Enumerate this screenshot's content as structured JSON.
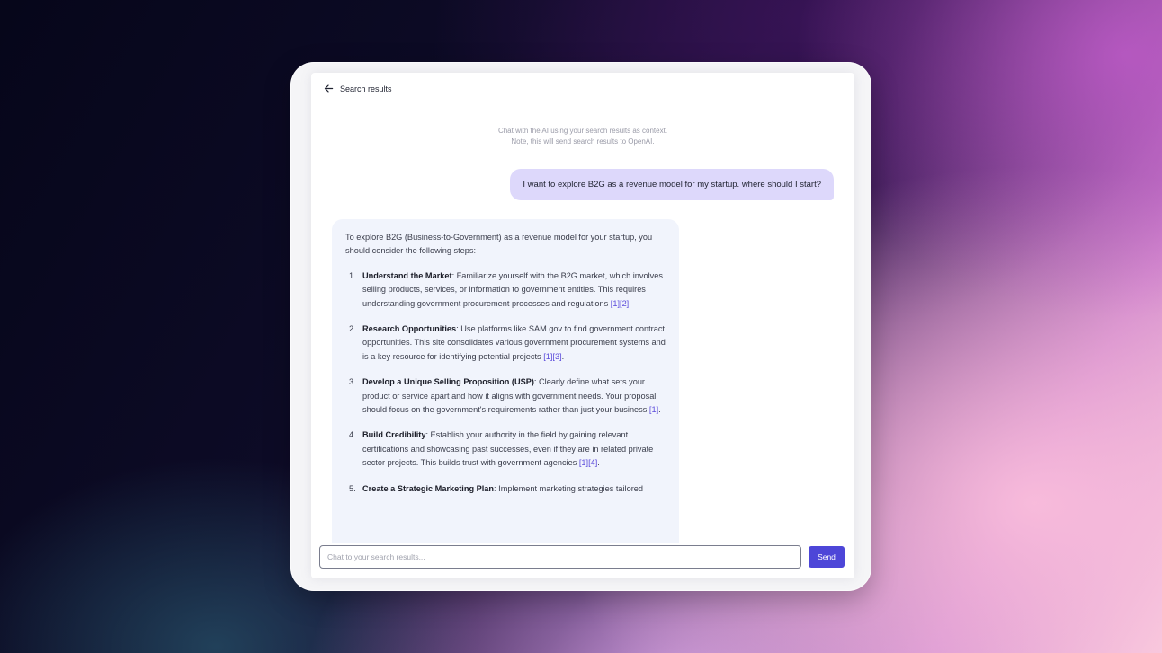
{
  "header": {
    "back_label": "Search results",
    "back_icon": "arrow-left-icon"
  },
  "hint": {
    "line1": "Chat with the AI using your search results as context.",
    "line2": "Note, this will send search results to OpenAI."
  },
  "messages": {
    "user": "I want to explore B2G as a revenue model for my startup. where should I start?",
    "ai": {
      "intro": "To explore B2G (Business-to-Government) as a revenue model for your startup, you should consider the following steps:",
      "steps": [
        {
          "num": "1.",
          "title": "Understand the Market",
          "text": ": Familiarize yourself with the B2G market, which involves selling products, services, or information to government entities. This requires understanding government procurement processes and regulations ",
          "cites": "[1][2]",
          "end": "."
        },
        {
          "num": "2.",
          "title": "Research Opportunities",
          "text": ": Use platforms like SAM.gov to find government contract opportunities. This site consolidates various government procurement systems and is a key resource for identifying potential projects ",
          "cites": "[1][3]",
          "end": "."
        },
        {
          "num": "3.",
          "title": "Develop a Unique Selling Proposition (USP)",
          "text": ": Clearly define what sets your product or service apart and how it aligns with government needs. Your proposal should focus on the government's requirements rather than just your business ",
          "cites": "[1]",
          "end": "."
        },
        {
          "num": "4.",
          "title": "Build Credibility",
          "text": ": Establish your authority in the field by gaining relevant certifications and showcasing past successes, even if they are in related private sector projects. This builds trust with government agencies ",
          "cites": "[1][4]",
          "end": "."
        },
        {
          "num": "5.",
          "title": "Create a Strategic Marketing Plan",
          "text": ": Implement marketing strategies tailored",
          "cites": "",
          "end": ""
        }
      ]
    }
  },
  "composer": {
    "placeholder": "Chat to your search results...",
    "send_label": "Send"
  },
  "colors": {
    "accent": "#4d46d8",
    "user_bubble": "#ddd8fb",
    "ai_bubble": "#f1f4fc",
    "citation": "#5b4bdb"
  }
}
